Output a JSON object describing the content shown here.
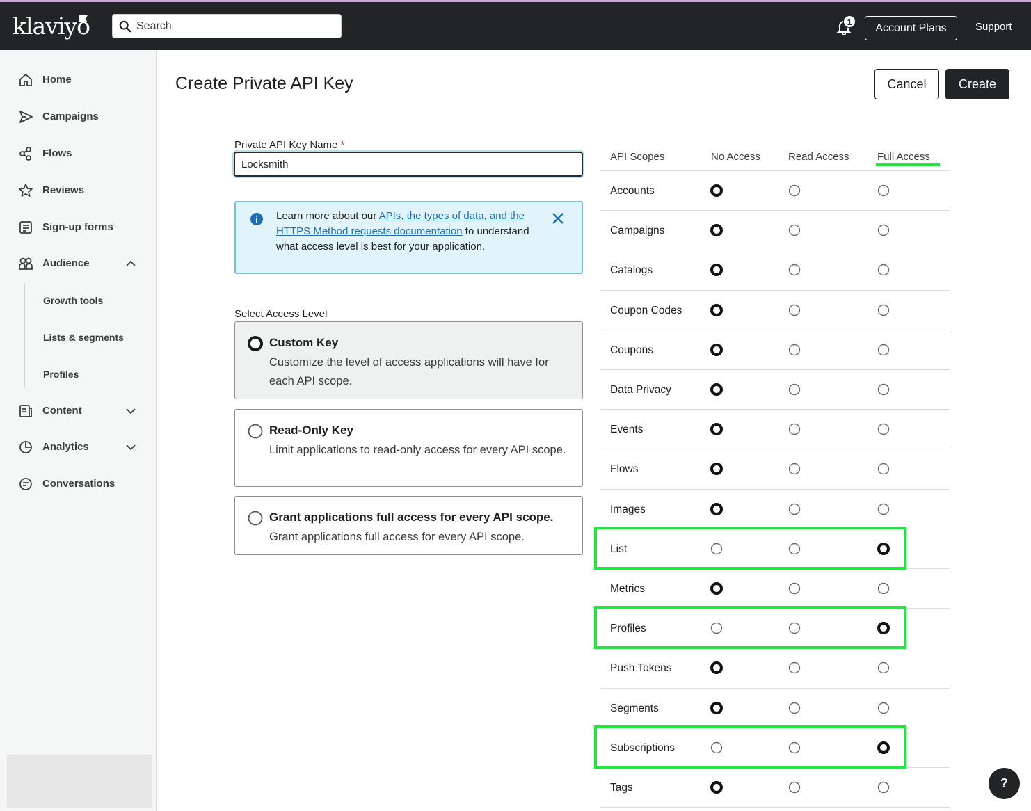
{
  "topbar": {
    "logo_text": "klaviyo",
    "search_placeholder": "Search",
    "notification_count": "1",
    "account_plans_label": "Account Plans",
    "support_label": "Support"
  },
  "sidebar": {
    "items": [
      {
        "label": "Home",
        "icon": "home-icon"
      },
      {
        "label": "Campaigns",
        "icon": "send-icon"
      },
      {
        "label": "Flows",
        "icon": "flows-icon"
      },
      {
        "label": "Reviews",
        "icon": "star-icon"
      },
      {
        "label": "Sign-up forms",
        "icon": "form-icon"
      },
      {
        "label": "Audience",
        "icon": "audience-icon",
        "expanded": true
      },
      {
        "label": "Content",
        "icon": "content-icon",
        "expanded": false
      },
      {
        "label": "Analytics",
        "icon": "analytics-icon",
        "expanded": false
      },
      {
        "label": "Conversations",
        "icon": "chat-icon"
      }
    ],
    "audience_sub": [
      "Growth tools",
      "Lists & segments",
      "Profiles"
    ]
  },
  "header": {
    "title": "Create Private API Key",
    "cancel_label": "Cancel",
    "create_label": "Create"
  },
  "form": {
    "name_label": "Private API Key Name",
    "required_mark": "*",
    "name_value": "Locksmith",
    "info_prefix": "Learn more about our ",
    "info_link": "APIs, the types of data, and the HTTPS Method requests documentation",
    "info_suffix": " to understand what access level is best for your application.",
    "select_label": "Select Access Level",
    "options": [
      {
        "title": "Custom Key",
        "desc": "Customize the level of access applications will have for each API scope.",
        "selected": true
      },
      {
        "title": "Read-Only Key",
        "desc": "Limit applications to read-only access for every API scope.",
        "selected": false
      },
      {
        "title": "Grant applications full access for every API scope.",
        "desc": "Grant applications full access for every API scope.",
        "selected": false
      }
    ]
  },
  "scopes": {
    "headers": [
      "API Scopes",
      "No Access",
      "Read Access",
      "Full Access"
    ],
    "rows": [
      {
        "label": "Accounts",
        "level": "none"
      },
      {
        "label": "Campaigns",
        "level": "none"
      },
      {
        "label": "Catalogs",
        "level": "none"
      },
      {
        "label": "Coupon Codes",
        "level": "none"
      },
      {
        "label": "Coupons",
        "level": "none"
      },
      {
        "label": "Data Privacy",
        "level": "none"
      },
      {
        "label": "Events",
        "level": "none"
      },
      {
        "label": "Flows",
        "level": "none"
      },
      {
        "label": "Images",
        "level": "none"
      },
      {
        "label": "List",
        "level": "full",
        "highlighted": true
      },
      {
        "label": "Metrics",
        "level": "none"
      },
      {
        "label": "Profiles",
        "level": "full",
        "highlighted": true
      },
      {
        "label": "Push Tokens",
        "level": "none"
      },
      {
        "label": "Segments",
        "level": "none"
      },
      {
        "label": "Subscriptions",
        "level": "full",
        "highlighted": true
      },
      {
        "label": "Tags",
        "level": "none"
      }
    ]
  },
  "help_label": "?",
  "colors": {
    "topbar_bg": "#232426",
    "highlight": "#22e53e",
    "info_bg": "#e1f3fb",
    "info_border": "#70c1e3",
    "link": "#1e6fb8"
  }
}
